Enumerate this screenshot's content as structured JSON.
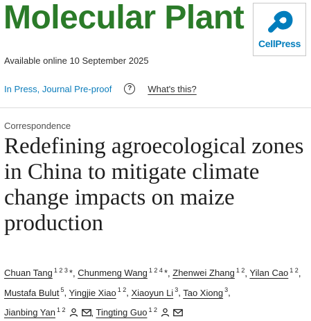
{
  "journal": {
    "name": "Molecular Plant"
  },
  "publisher": {
    "logo_text": "CellPress",
    "brand_color": "#007dbc"
  },
  "availability": {
    "text": "Available online 10 September 2025"
  },
  "status": {
    "link_text": "In Press, Journal Pre-proof",
    "help_icon": "question-circle-icon",
    "whats_this": "What's this?"
  },
  "article": {
    "type": "Correspondence",
    "title": "Redefining agroecological zones in China to mitigate climate change impacts on maize production"
  },
  "authors": [
    {
      "name": "Chuan Tang",
      "affiliations": "1 2 3",
      "corresponding": "*"
    },
    {
      "name": "Chunmeng Wang",
      "affiliations": "1 2 4",
      "corresponding": "*"
    },
    {
      "name": "Zhenwei Zhang",
      "affiliations": "1 2"
    },
    {
      "name": "Yilan Cao",
      "affiliations": "1 2"
    },
    {
      "name": "Mustafa Bulut",
      "affiliations": "5"
    },
    {
      "name": "Yingjie Xiao",
      "affiliations": "1 2"
    },
    {
      "name": "Xiaoyun Li",
      "affiliations": "3"
    },
    {
      "name": "Tao Xiong",
      "affiliations": "3"
    },
    {
      "name": "Jianbing Yan",
      "affiliations": "1 2",
      "icons": [
        "person-icon",
        "email-icon"
      ]
    },
    {
      "name": "Tingting Guo",
      "affiliations": "1 2",
      "icons": [
        "person-icon",
        "email-icon"
      ]
    }
  ],
  "colors": {
    "journal_green": "#2b7b29",
    "link_blue": "#0c7dbb",
    "text": "#2e2e2e"
  },
  "separator": ","
}
